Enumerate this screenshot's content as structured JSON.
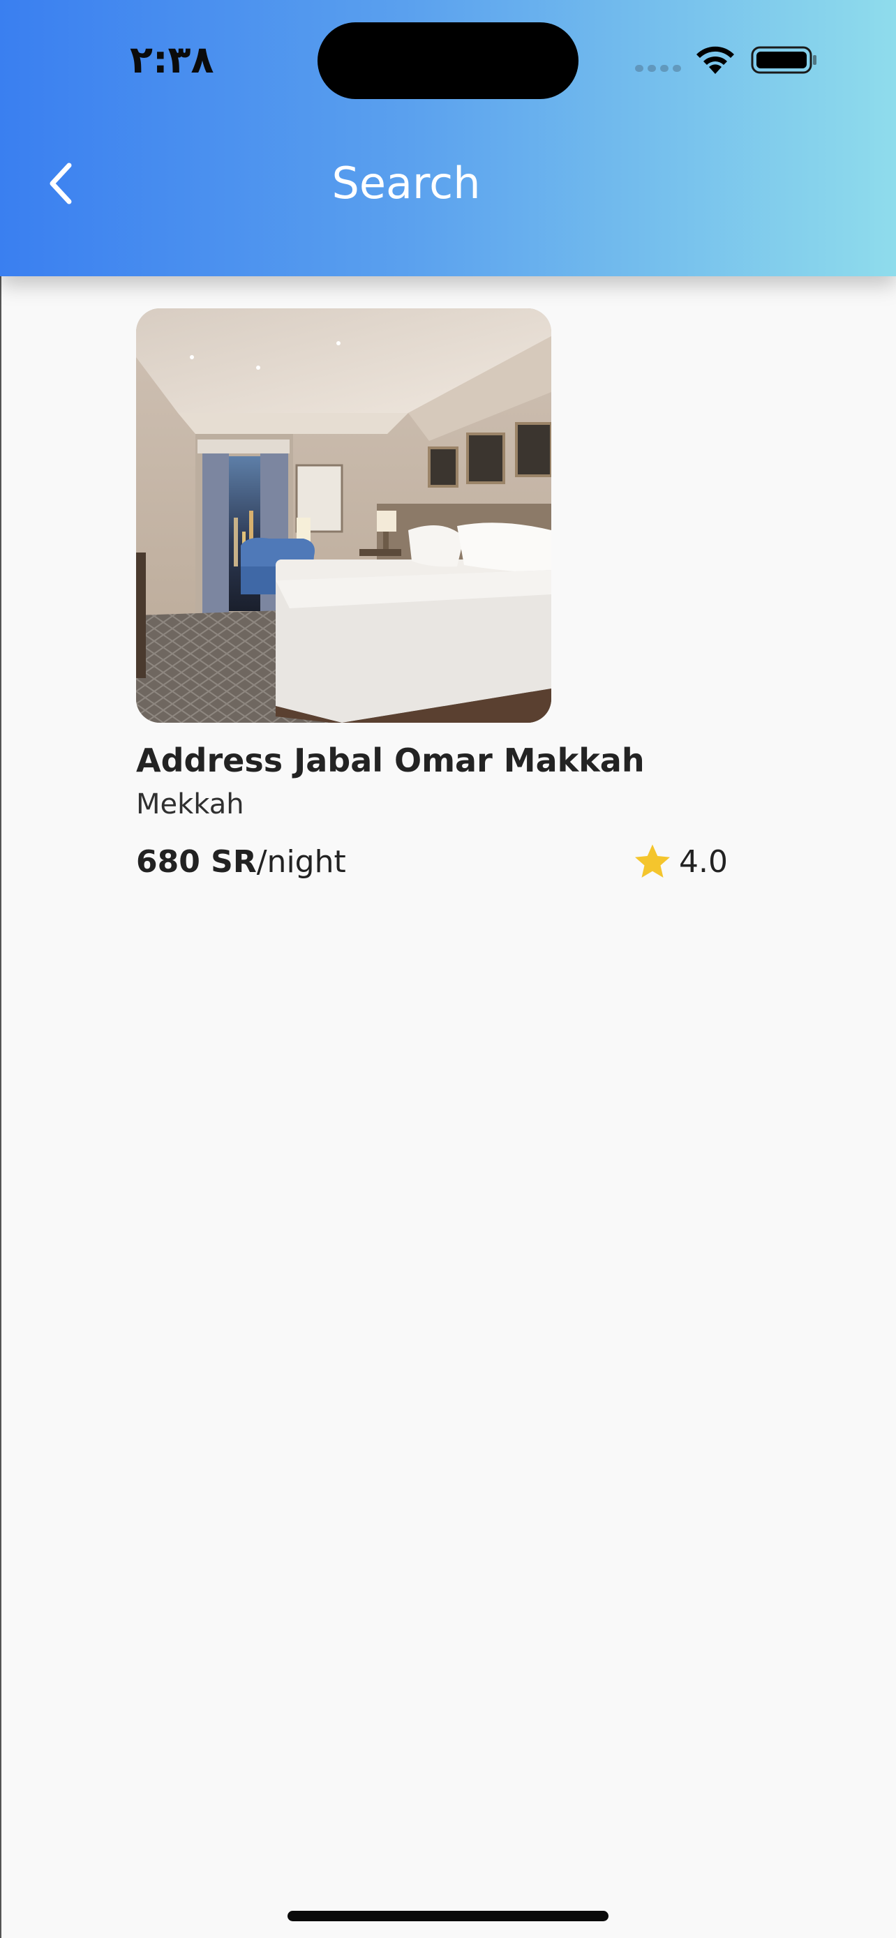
{
  "status_bar": {
    "time": "٢:٣٨"
  },
  "header": {
    "title": "Search",
    "gradient_start": "#3a7ff0",
    "gradient_end": "#8fdcec"
  },
  "results": [
    {
      "name": "Address Jabal Omar Makkah",
      "city": "Mekkah",
      "price": "680 SR",
      "price_unit": "/night",
      "rating": "4.0",
      "image": "hotel-room-photo"
    }
  ],
  "icons": {
    "back": "chevron-left-icon",
    "rating": "star-icon",
    "wifi": "wifi-icon",
    "battery": "battery-icon"
  },
  "colors": {
    "star": "#f4c52d",
    "background": "#f9f9f9"
  }
}
